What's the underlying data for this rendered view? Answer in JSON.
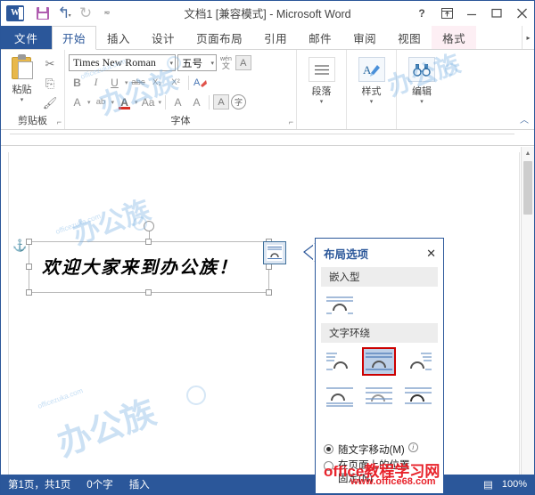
{
  "titlebar": {
    "title": "文档1 [兼容模式] - Microsoft Word",
    "app_logo": "word-logo",
    "quick_access": [
      {
        "name": "save-icon",
        "label": "保存"
      },
      {
        "name": "undo-icon",
        "label": "撤消"
      },
      {
        "name": "redo-icon",
        "label": "恢复"
      },
      {
        "name": "customize-qat-icon",
        "label": "自定义快速访问工具栏"
      }
    ],
    "window_buttons": [
      {
        "name": "help-button",
        "glyph": "?"
      },
      {
        "name": "ribbon-display-options-button",
        "glyph": "⊞"
      },
      {
        "name": "minimize-button",
        "glyph": "—"
      },
      {
        "name": "maximize-button",
        "glyph": "☐"
      },
      {
        "name": "close-button",
        "glyph": "✕"
      }
    ]
  },
  "tabs": {
    "file": "文件",
    "items": [
      {
        "label": "开始",
        "active": true
      },
      {
        "label": "插入",
        "active": false
      },
      {
        "label": "设计",
        "active": false
      },
      {
        "label": "页面布局",
        "active": false
      },
      {
        "label": "引用",
        "active": false
      },
      {
        "label": "邮件",
        "active": false
      },
      {
        "label": "审阅",
        "active": false
      },
      {
        "label": "视图",
        "active": false
      },
      {
        "label": "格式",
        "active": false,
        "contextual": true
      }
    ],
    "scroll_more": "▸"
  },
  "ribbon": {
    "groups": [
      {
        "name": "clipboard",
        "label": "剪贴板",
        "paste_label": "粘贴"
      },
      {
        "name": "font",
        "label": "字体"
      },
      {
        "name": "paragraph",
        "label": "段落"
      },
      {
        "name": "styles",
        "label": "样式"
      },
      {
        "name": "editing",
        "label": "编辑"
      }
    ],
    "font": {
      "font_name": "Times New Roman",
      "font_size": "五号",
      "bold": "B",
      "italic": "I",
      "underline": "U",
      "strikethrough": "abc",
      "subscript": "X₂",
      "superscript": "X²",
      "clear_format": "A",
      "text_effects": "A",
      "highlight": "ab",
      "font_color": "A",
      "change_case": "Aa",
      "grow_font": "A",
      "shrink_font": "A",
      "phonetic_guide": "文",
      "char_border": "A",
      "char_shading": "字"
    },
    "collapse_ribbon": "︿"
  },
  "document": {
    "wordart_text": "欢迎大家来到办公族！",
    "anchor": "anchor-icon"
  },
  "layout_options": {
    "title": "布局选项",
    "close": "✕",
    "section_inline": "嵌入型",
    "section_wrap": "文字环绕",
    "inline_option": {
      "name": "in-line-with-text",
      "selected": false
    },
    "wrap_options": [
      {
        "name": "square-wrap",
        "selected": false
      },
      {
        "name": "tight-wrap",
        "selected": true
      },
      {
        "name": "through-wrap",
        "selected": false
      },
      {
        "name": "top-and-bottom-wrap",
        "selected": false
      },
      {
        "name": "behind-text-wrap",
        "selected": false
      },
      {
        "name": "in-front-of-text-wrap",
        "selected": false
      }
    ],
    "radio_move": {
      "label": "随文字移动(M)",
      "accel": "M",
      "selected": true
    },
    "radio_fix_line1": "在页面上的位置",
    "radio_fix_line2": "固定(N)",
    "radio_fix_accel": "N",
    "radio_fix_selected": false,
    "info_icon": "info-icon"
  },
  "statusbar": {
    "page_info": "第1页，共1页",
    "word_count": "0个字",
    "insert_mode": "插入",
    "zoom": "100%",
    "proof_icon": "proofing-icon"
  },
  "watermarks": {
    "brand_cn": "办公族",
    "brand_en": "officezuka.com",
    "red_main": "office教程学习网",
    "red_sub": "www.office68.com"
  },
  "colors": {
    "accent_blue": "#2b579a",
    "ribbon_bg": "#ffffff",
    "contextual_tab": "#fdeff4",
    "selection_red": "#cc0000",
    "selected_fill": "#bdd0e8",
    "watermark_blue": "#78afe1",
    "watermark_red": "#e8232b"
  }
}
